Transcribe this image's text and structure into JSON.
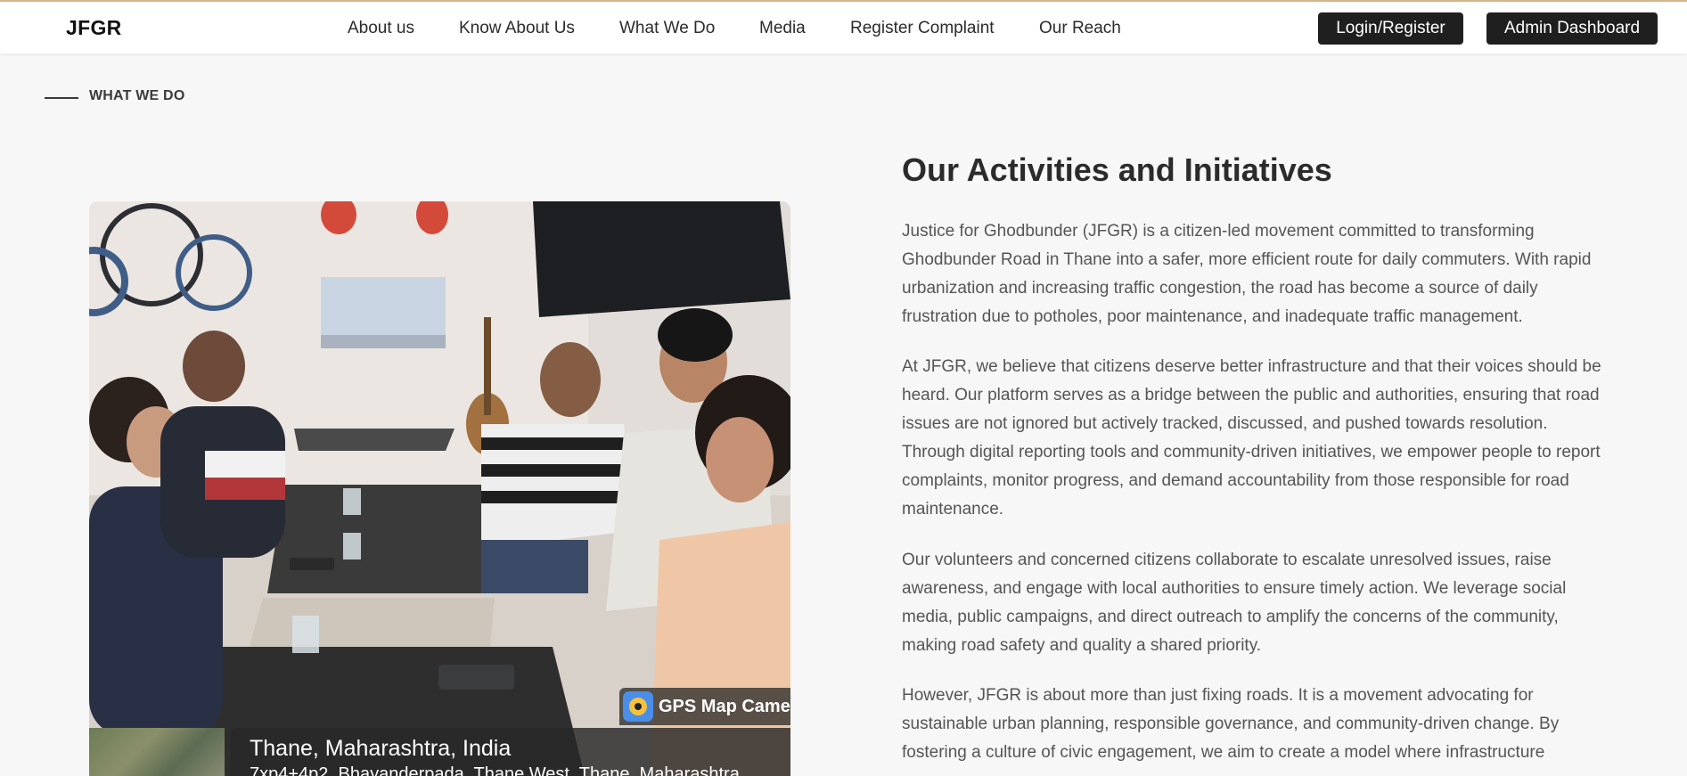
{
  "header": {
    "brand": "JFGR",
    "nav": [
      "About us",
      "Know About Us",
      "What We Do",
      "Media",
      "Register Complaint",
      "Our Reach"
    ],
    "login_label": "Login/Register",
    "admin_label": "Admin Dashboard",
    "accent_color": "#d4b48c"
  },
  "section": {
    "eyebrow": "WHAT WE DO",
    "heading": "Our Activities and Initiatives",
    "paragraphs": [
      "Justice for Ghodbunder (JFGR) is a citizen-led movement committed to transforming Ghodbunder Road in Thane into a safer, more efficient route for daily commuters. With rapid urbanization and increasing traffic congestion, the road has become a source of daily frustration due to potholes, poor maintenance, and inadequate traffic management.",
      "At JFGR, we believe that citizens deserve better infrastructure and that their voices should be heard. Our platform serves as a bridge between the public and authorities, ensuring that road issues are not ignored but actively tracked, discussed, and pushed towards resolution. Through digital reporting tools and community-driven initiatives, we empower people to report complaints, monitor progress, and demand accountability from those responsible for road maintenance.",
      "Our volunteers and concerned citizens collaborate to escalate unresolved issues, raise awareness, and engage with local authorities to ensure timely action. We leverage social media, public campaigns, and direct outreach to amplify the concerns of the community, making road safety and quality a shared priority.",
      "However, JFGR is about more than just fixing roads. It is a movement advocating for sustainable urban planning, responsible governance, and community-driven change. By fostering a culture of civic engagement, we aim to create a model where infrastructure"
    ]
  },
  "photo": {
    "gps_app_label": "GPS Map Came",
    "city": "Thane, Maharashtra, India",
    "address": "7xp4+4p2, Bhayanderpada, Thane West, Thane, Maharashtra"
  }
}
